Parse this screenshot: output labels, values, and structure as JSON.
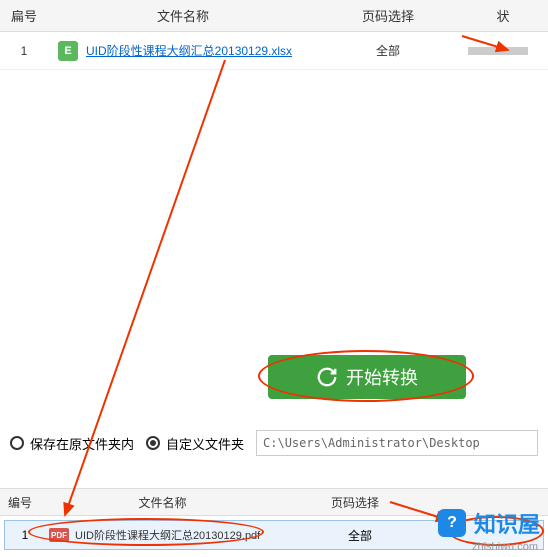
{
  "topTable": {
    "headers": {
      "num": "扁号",
      "name": "文件名称",
      "page": "页码选择",
      "status": "状"
    },
    "rows": [
      {
        "num": "1",
        "fileIconText": "E",
        "fileName": "UID阶段性课程大纲汇总20130129.xlsx",
        "pageSelect": "全部"
      }
    ]
  },
  "startButton": {
    "label": "开始转换"
  },
  "saveOptions": {
    "sameFolder": "保存在原文件夹内",
    "customFolder": "自定义文件夹",
    "path": "C:\\Users\\Administrator\\Desktop"
  },
  "bottomTable": {
    "headers": {
      "num": "编号",
      "name": "文件名称",
      "page": "页码选择"
    },
    "rows": [
      {
        "num": "1",
        "fileIconText": "PDF",
        "fileName": "UID阶段性课程大纲汇总20130129.pdf",
        "pageSelect": "全部"
      }
    ]
  },
  "watermark": {
    "text": "知识屋",
    "url": "zhishiwu.com",
    "iconGlyph": "?"
  }
}
